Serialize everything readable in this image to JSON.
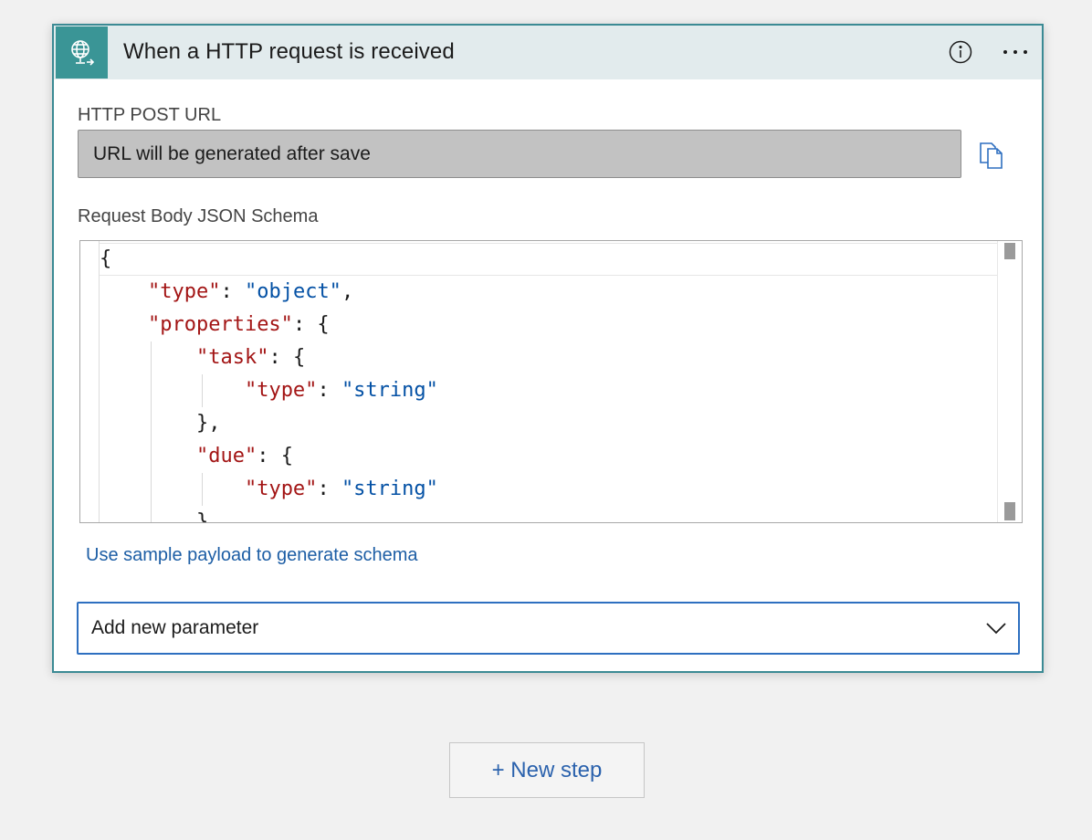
{
  "card": {
    "title": "When a HTTP request is received",
    "trigger_icon": "globe-request-icon",
    "info_icon": "info-icon",
    "more_icon": "more-options-icon"
  },
  "url_field": {
    "label": "HTTP POST URL",
    "value": "URL will be generated after save",
    "copy_icon": "copy-icon"
  },
  "schema": {
    "label": "Request Body JSON Schema",
    "lines": [
      [
        "{"
      ],
      [
        "    ",
        "\"type\"",
        ": ",
        "\"object\"",
        ","
      ],
      [
        "    ",
        "\"properties\"",
        ": {"
      ],
      [
        "        ",
        "\"task\"",
        ": {"
      ],
      [
        "            ",
        "\"type\"",
        ": ",
        "\"string\""
      ],
      [
        "        },"
      ],
      [
        "        ",
        "\"due\"",
        ": {"
      ],
      [
        "            ",
        "\"type\"",
        ": ",
        "\"string\""
      ],
      [
        "        }"
      ]
    ]
  },
  "sample_link": "Use sample payload to generate schema",
  "add_parameter": {
    "value": "Add new parameter",
    "chevron_icon": "chevron-down-icon"
  },
  "new_step": "+ New step",
  "colors": {
    "accent": "#3a9596",
    "header_bg": "#e2ebed",
    "link": "#1d5ea5",
    "json_key": "#a31515",
    "json_string": "#0451a5",
    "select_border": "#2e6fc0"
  }
}
